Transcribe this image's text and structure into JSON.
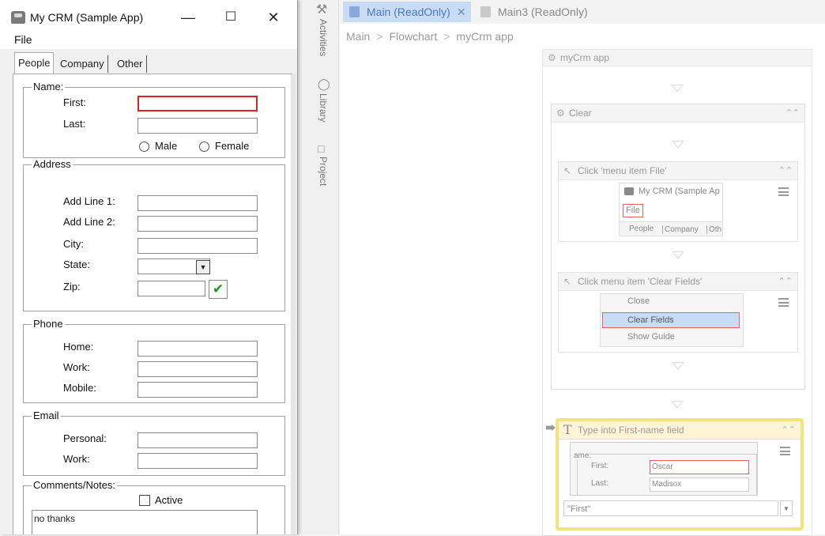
{
  "crm_window": {
    "title": "My CRM (Sample App)",
    "menu": {
      "file": "File"
    },
    "tabs": [
      "People",
      "Company",
      "Other"
    ],
    "name_group": {
      "legend": "Name:",
      "first_label": "First:",
      "last_label": "Last:",
      "first_value": "",
      "last_value": "",
      "male_label": "Male",
      "female_label": "Female"
    },
    "address_group": {
      "legend": "Address",
      "line1_label": "Add Line 1:",
      "line2_label": "Add Line 2:",
      "city_label": "City:",
      "state_label": "State:",
      "zip_label": "Zip:"
    },
    "phone_group": {
      "legend": "Phone",
      "home_label": "Home:",
      "work_label": "Work:",
      "mobile_label": "Mobile:"
    },
    "email_group": {
      "legend": "Email",
      "personal_label": "Personal:",
      "work_label": "Work:"
    },
    "comments_group": {
      "legend": "Comments/Notes:",
      "active_label": "Active",
      "notes_value": "no thanks"
    }
  },
  "dock": {
    "activities": "Activities",
    "library": "Library",
    "project": "Project"
  },
  "designer": {
    "tabs": [
      {
        "label": "Main (ReadOnly)",
        "active": true
      },
      {
        "label": "Main3 (ReadOnly)",
        "active": false
      }
    ],
    "breadcrumb": [
      "Main",
      "Flowchart",
      "myCrm app"
    ],
    "sequence_title": "myCrm app",
    "clear_title": "Clear",
    "click_file": {
      "title": "Click 'menu item  File'",
      "thumb_title": "My CRM (Sample Ap",
      "thumb_file": "File",
      "thumb_tabs": [
        "People",
        "Company",
        "Oth"
      ]
    },
    "click_clear": {
      "title": "Click menu item  'Clear Fields'",
      "thumb_items": [
        "Close",
        "Clear Fields",
        "Show Guide"
      ]
    },
    "type_into": {
      "title": "Type into First-name field",
      "thumb_group": "ame:",
      "thumb_first_label": "First:",
      "thumb_first_value": "Oscar",
      "thumb_last_label": "Last:",
      "thumb_last_value": "Madisox",
      "text_value": "\"First\""
    }
  },
  "colors": {
    "accent_tab": "#c8dcf6",
    "selection_border": "#e02020",
    "highlight_card": "#fff4d6",
    "highlight_border": "#f4e27a"
  }
}
